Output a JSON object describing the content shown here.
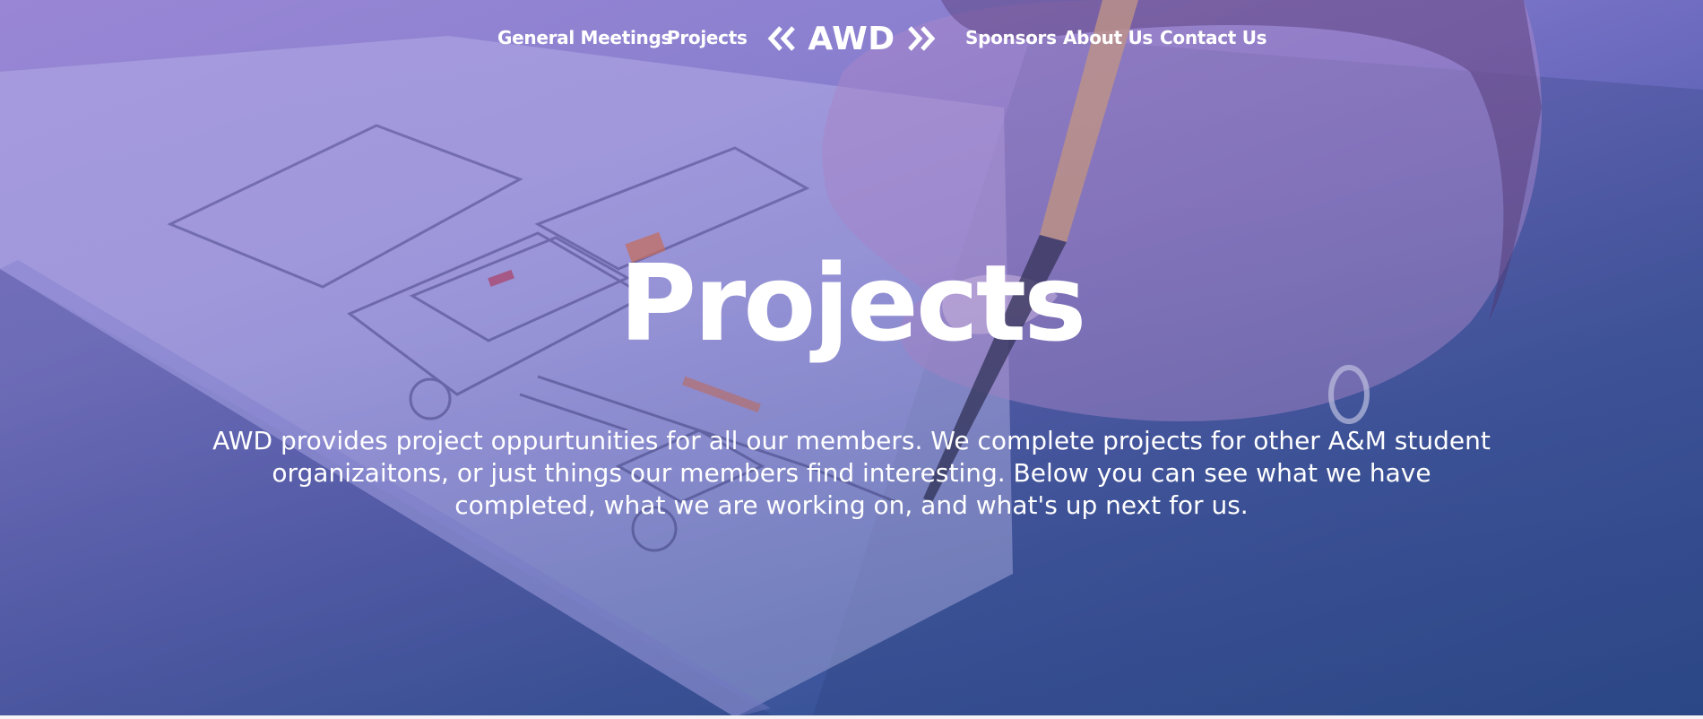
{
  "nav": {
    "left_links": [
      "General Meetings",
      "Projects"
    ],
    "logo_text": "AWD",
    "right_links": [
      "Sponsors",
      "About Us",
      "Contact Us"
    ]
  },
  "hero": {
    "title": "Projects",
    "description": "AWD provides project oppurtunities for all our members. We complete projects for other A&M student organizaitons, or just things our members find interesting. Below you can see what we have completed, what we are working on, and what's up next for us.",
    "background_image": "hand-sketching-wireframe-photo",
    "overlay_colors": [
      "#9b8ad4",
      "#6f6fbf",
      "#2f4c8a"
    ]
  },
  "icons": [
    "chevron-double-left-icon",
    "chevron-double-right-icon"
  ]
}
